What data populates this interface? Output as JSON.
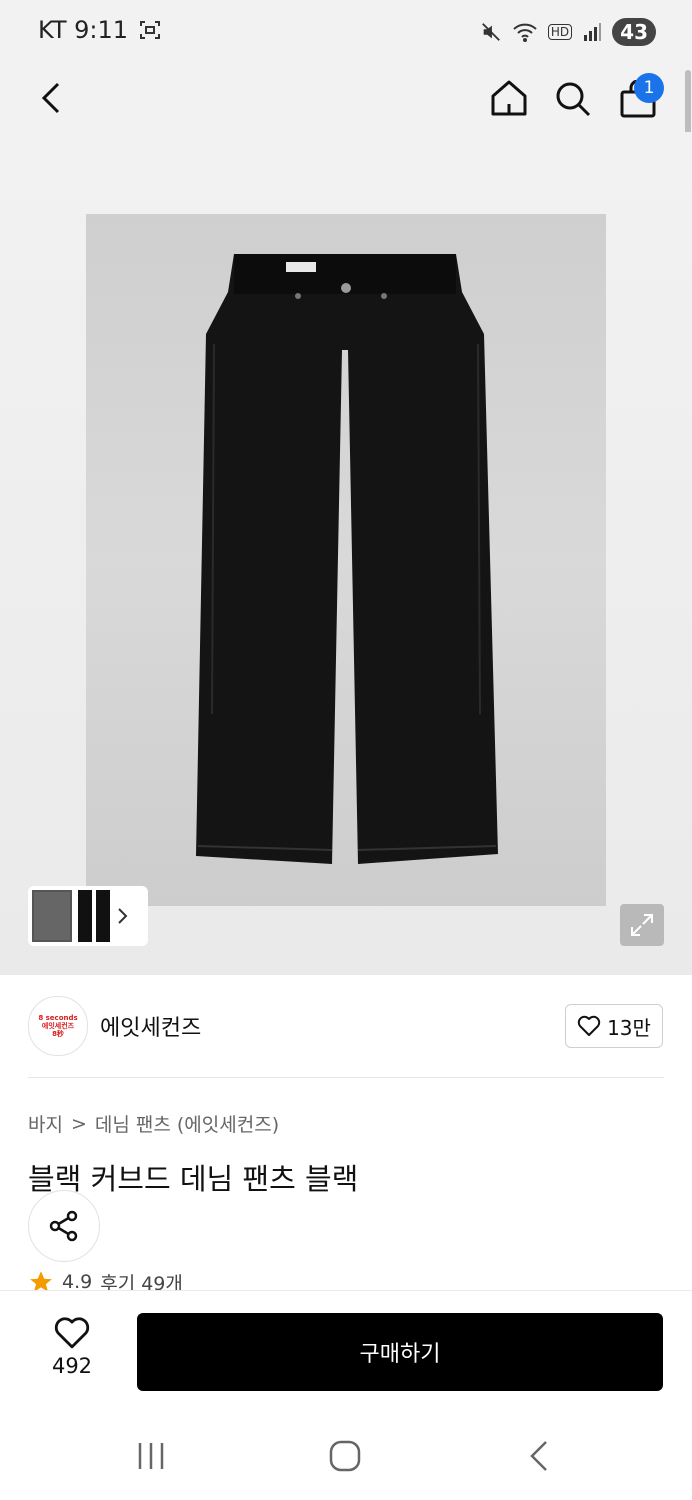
{
  "status": {
    "carrier_time": "KT 9:11",
    "battery": "43",
    "hd": "HD"
  },
  "nav": {
    "cart_count": "1"
  },
  "brand": {
    "logo_lines": [
      "8 seconds",
      "에잇세컨즈",
      "8秒"
    ],
    "name": "에잇세컨즈",
    "likes": "13만"
  },
  "breadcrumb": {
    "category": "바지",
    "separator": ">",
    "subcategory": "데님 팬츠 (에잇세컨즈)"
  },
  "product": {
    "title": "블랙 커브드 데님 팬츠 블랙",
    "rating": "4.9",
    "reviews": "후기 49개"
  },
  "bottom": {
    "wish_count": "492",
    "buy_label": "구매하기"
  },
  "colors": {
    "accent_badge": "#1a73e8",
    "buy_button": "#000000",
    "star": "#f59a00"
  }
}
